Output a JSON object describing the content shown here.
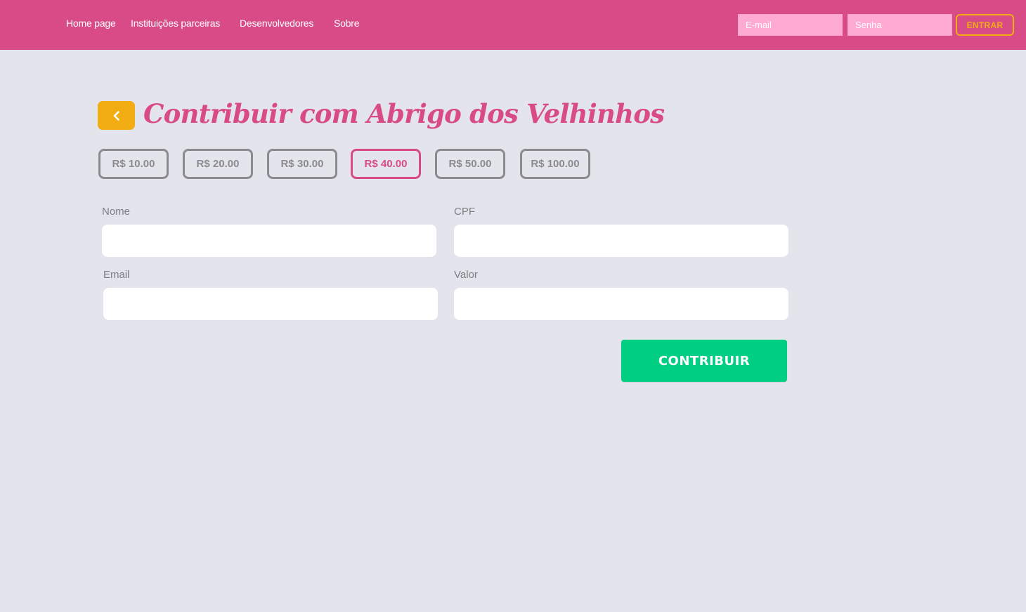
{
  "navbar": {
    "links": [
      "Home page",
      "Instituições parceiras",
      "Desenvolvedores",
      "Sobre"
    ],
    "email_placeholder": "E-mail",
    "password_placeholder": "Senha",
    "login_label": "ENTRAR"
  },
  "page": {
    "title": "Contribuir com Abrigo dos Velhinhos",
    "back_icon": "chevron-left-icon"
  },
  "amounts": {
    "options": [
      "R$ 10.00",
      "R$ 20.00",
      "R$ 30.00",
      "R$ 40.00",
      "R$ 50.00",
      "R$ 100.00"
    ],
    "selected": "R$ 40.00"
  },
  "form": {
    "name_label": "Nome",
    "cpf_label": "CPF",
    "email_label": "Email",
    "value_label": "Valor",
    "name_value": "",
    "cpf_value": "",
    "email_value": "",
    "value_value": "",
    "submit_label": "CONTRIBUIR"
  },
  "colors": {
    "navbar": "#d84b86",
    "accent": "#f2ad12",
    "title": "#d84b86",
    "submit": "#00cf83",
    "background": "#e4e4ed"
  }
}
